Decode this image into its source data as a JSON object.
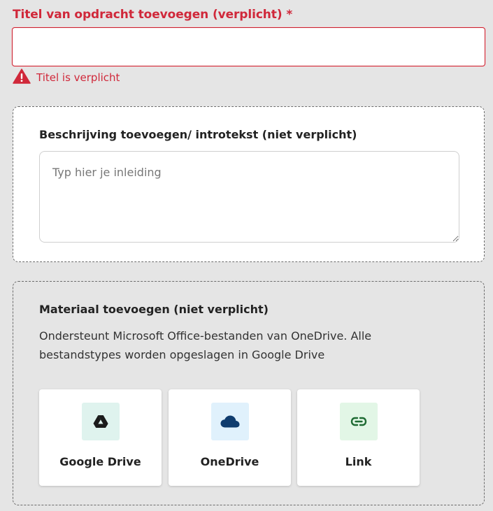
{
  "title_field": {
    "label": "Titel van opdracht toevoegen (verplicht) *",
    "value": "",
    "error": "Titel is verplicht"
  },
  "description": {
    "heading": "Beschrijving toevoegen/ introtekst (niet verplicht)",
    "placeholder": "Typ hier je inleiding",
    "value": ""
  },
  "material": {
    "heading": "Materiaal toevoegen (niet verplicht)",
    "support_text": "Ondersteunt Microsoft Office-bestanden van OneDrive. Alle bestandstypes worden opgeslagen in Google Drive",
    "options": [
      {
        "label": "Google Drive",
        "icon": "google-drive-icon",
        "bg": "#dff3ee"
      },
      {
        "label": "OneDrive",
        "icon": "onedrive-icon",
        "bg": "#e0f1fc"
      },
      {
        "label": "Link",
        "icon": "link-icon",
        "bg": "#e2f6e6"
      }
    ]
  },
  "colors": {
    "error": "#d0283a",
    "background": "#e5e5e5",
    "onedrive_blue": "#0f3c6e",
    "link_green": "#1e6b33"
  }
}
